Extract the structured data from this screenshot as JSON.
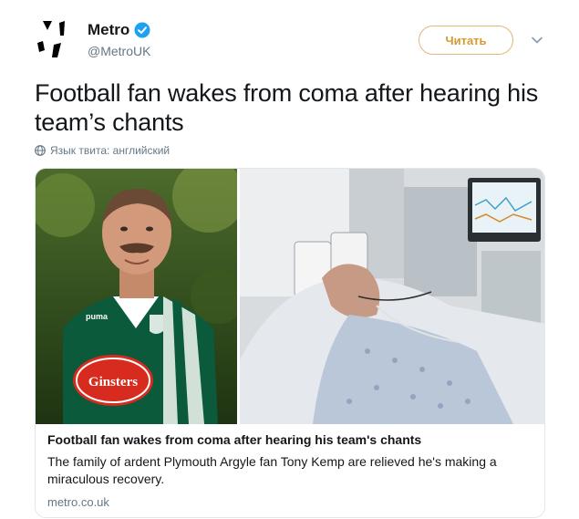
{
  "account": {
    "display_name": "Metro",
    "handle": "@MetroUK",
    "verified": true
  },
  "follow_button": {
    "label": "Читать"
  },
  "tweet": {
    "text": "Football fan wakes from coma after hearing his team’s chants",
    "language_note": "Язык твита: английский"
  },
  "card": {
    "title": "Football fan wakes from coma after hearing his team's chants",
    "description": "The family of ardent Plymouth Argyle fan Tony Kemp are relieved he's making a miraculous recovery.",
    "domain": "metro.co.uk",
    "jersey_sponsor": "Ginsters",
    "jersey_brand": "puma"
  },
  "colors": {
    "accent": "#d79a33",
    "verified_blue": "#1da1f2",
    "jersey_green": "#0b5a3c",
    "sponsor_red": "#d62b1e",
    "muted_text": "#657786"
  },
  "icons": {
    "avatar": "metro-logo-icon",
    "verified": "verified-badge-icon",
    "menu": "chevron-down-icon",
    "language": "globe-icon"
  }
}
